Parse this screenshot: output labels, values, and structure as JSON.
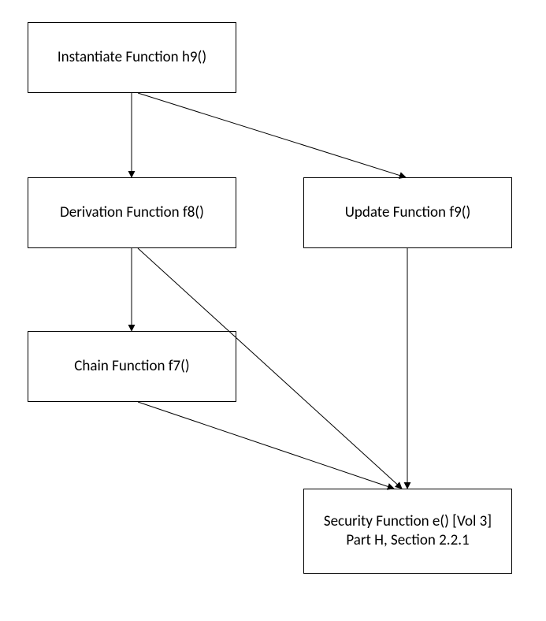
{
  "diagram": {
    "nodes": {
      "instantiate": {
        "label": "Instantiate Function h9()"
      },
      "derivation": {
        "label": "Derivation Function f8()"
      },
      "update": {
        "label": "Update Function f9()"
      },
      "chain": {
        "label": "Chain Function f7()"
      },
      "security": {
        "label": "Security Function e() [Vol 3] Part H, Section 2.2.1"
      }
    },
    "edges": [
      {
        "from": "instantiate",
        "to": "derivation"
      },
      {
        "from": "instantiate",
        "to": "update"
      },
      {
        "from": "derivation",
        "to": "chain"
      },
      {
        "from": "derivation",
        "to": "security"
      },
      {
        "from": "chain",
        "to": "security"
      },
      {
        "from": "update",
        "to": "security"
      }
    ]
  }
}
